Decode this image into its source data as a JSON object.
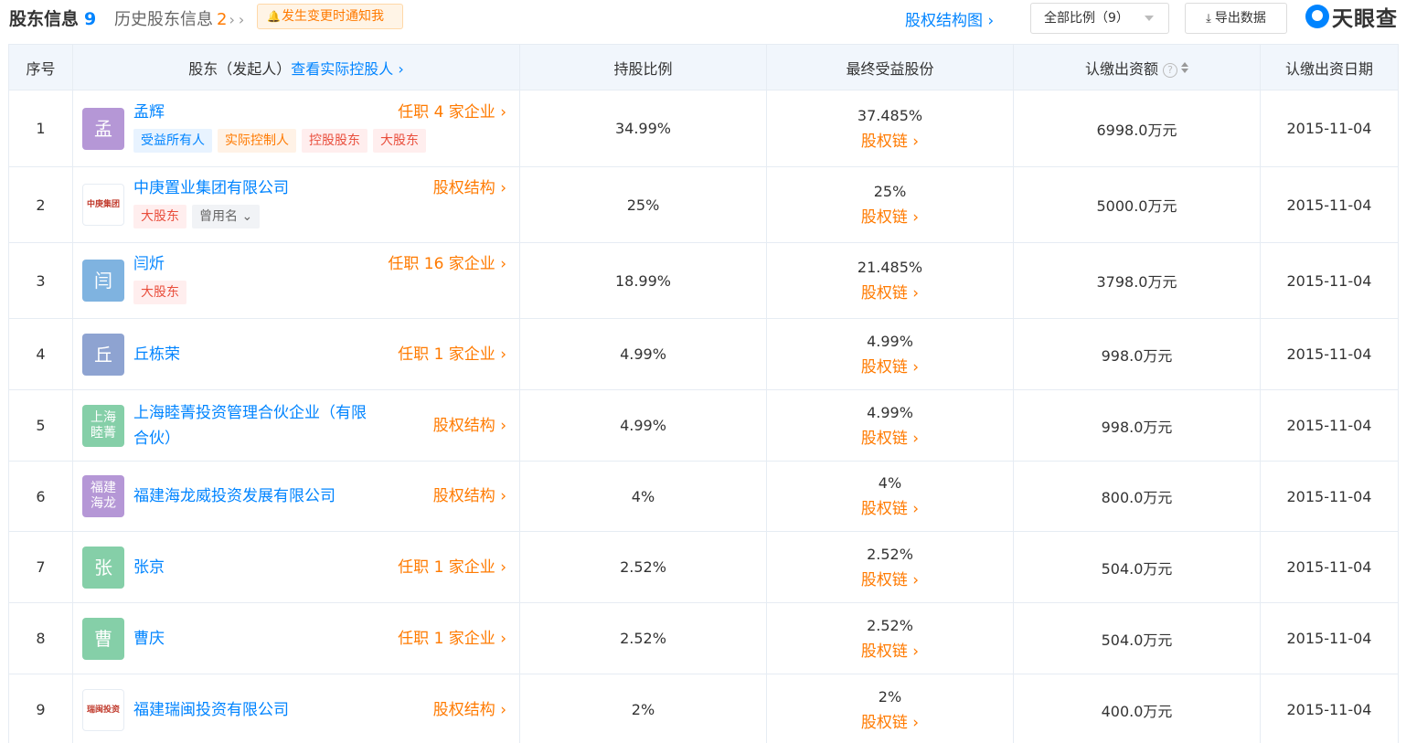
{
  "header": {
    "current_label": "股东信息",
    "current_count": "9",
    "history_label": "历史股东信息",
    "history_count": "2",
    "notify_label": "发生变更时通知我",
    "structure_link": "股权结构图",
    "filter_value": "全部比例（9）",
    "export_label": "导出数据",
    "logo_text": "天眼查"
  },
  "colors": {
    "accent_blue": "#0084ff",
    "accent_orange": "#ff7a00",
    "header_bg": "#f1f6fc"
  },
  "table": {
    "columns": {
      "idx": "序号",
      "holder": "股东（发起人）",
      "holder_link": "查看实际控股人",
      "ratio": "持股比例",
      "final": "最终受益股份",
      "amount": "认缴出资额",
      "date": "认缴出资日期"
    },
    "chain_label": "股权链",
    "rows": [
      {
        "idx": "1",
        "avatar": "孟",
        "avatar_color": "#b597d6",
        "name": "孟辉",
        "right": "任职 4 家企业",
        "tags": [
          {
            "text": "受益所有人",
            "style": "blue"
          },
          {
            "text": "实际控制人",
            "style": "orange"
          },
          {
            "text": "控股股东",
            "style": "red"
          },
          {
            "text": "大股东",
            "style": "red"
          }
        ],
        "ratio": "34.99%",
        "final": "37.485%",
        "amount": "6998.0万元",
        "date": "2015-11-04"
      },
      {
        "idx": "2",
        "avatar": "中庚集团",
        "avatar_color": "logo",
        "name": "中庚置业集团有限公司",
        "right": "股权结构",
        "tags": [
          {
            "text": "大股东",
            "style": "red"
          },
          {
            "text": "曾用名 ⌄",
            "style": "gray"
          }
        ],
        "ratio": "25%",
        "final": "25%",
        "amount": "5000.0万元",
        "date": "2015-11-04"
      },
      {
        "idx": "3",
        "avatar": "闫",
        "avatar_color": "#7fb3e0",
        "name": "闫炘",
        "right": "任职 16 家企业",
        "tags": [
          {
            "text": "大股东",
            "style": "red"
          }
        ],
        "ratio": "18.99%",
        "final": "21.485%",
        "amount": "3798.0万元",
        "date": "2015-11-04"
      },
      {
        "idx": "4",
        "avatar": "丘",
        "avatar_color": "#8ea3d1",
        "name": "丘栋荣",
        "right": "任职 1 家企业",
        "tags": [],
        "ratio": "4.99%",
        "final": "4.99%",
        "amount": "998.0万元",
        "date": "2015-11-04"
      },
      {
        "idx": "5",
        "avatar": "上海睦菁",
        "avatar_color": "#85cfa8",
        "name": "上海睦菁投资管理合伙企业（有限合伙）",
        "right": "股权结构",
        "tags": [],
        "ratio": "4.99%",
        "final": "4.99%",
        "amount": "998.0万元",
        "date": "2015-11-04"
      },
      {
        "idx": "6",
        "avatar": "福建海龙",
        "avatar_color": "#b597d6",
        "name": "福建海龙威投资发展有限公司",
        "right": "股权结构",
        "tags": [],
        "ratio": "4%",
        "final": "4%",
        "amount": "800.0万元",
        "date": "2015-11-04"
      },
      {
        "idx": "7",
        "avatar": "张",
        "avatar_color": "#85cfa8",
        "name": "张京",
        "right": "任职 1 家企业",
        "tags": [],
        "ratio": "2.52%",
        "final": "2.52%",
        "amount": "504.0万元",
        "date": "2015-11-04"
      },
      {
        "idx": "8",
        "avatar": "曹",
        "avatar_color": "#85cfa8",
        "name": "曹庆",
        "right": "任职 1 家企业",
        "tags": [],
        "ratio": "2.52%",
        "final": "2.52%",
        "amount": "504.0万元",
        "date": "2015-11-04"
      },
      {
        "idx": "9",
        "avatar": "瑞闽投资",
        "avatar_color": "logo",
        "name": "福建瑞闽投资有限公司",
        "right": "股权结构",
        "tags": [],
        "ratio": "2%",
        "final": "2%",
        "amount": "400.0万元",
        "date": "2015-11-04"
      }
    ]
  }
}
